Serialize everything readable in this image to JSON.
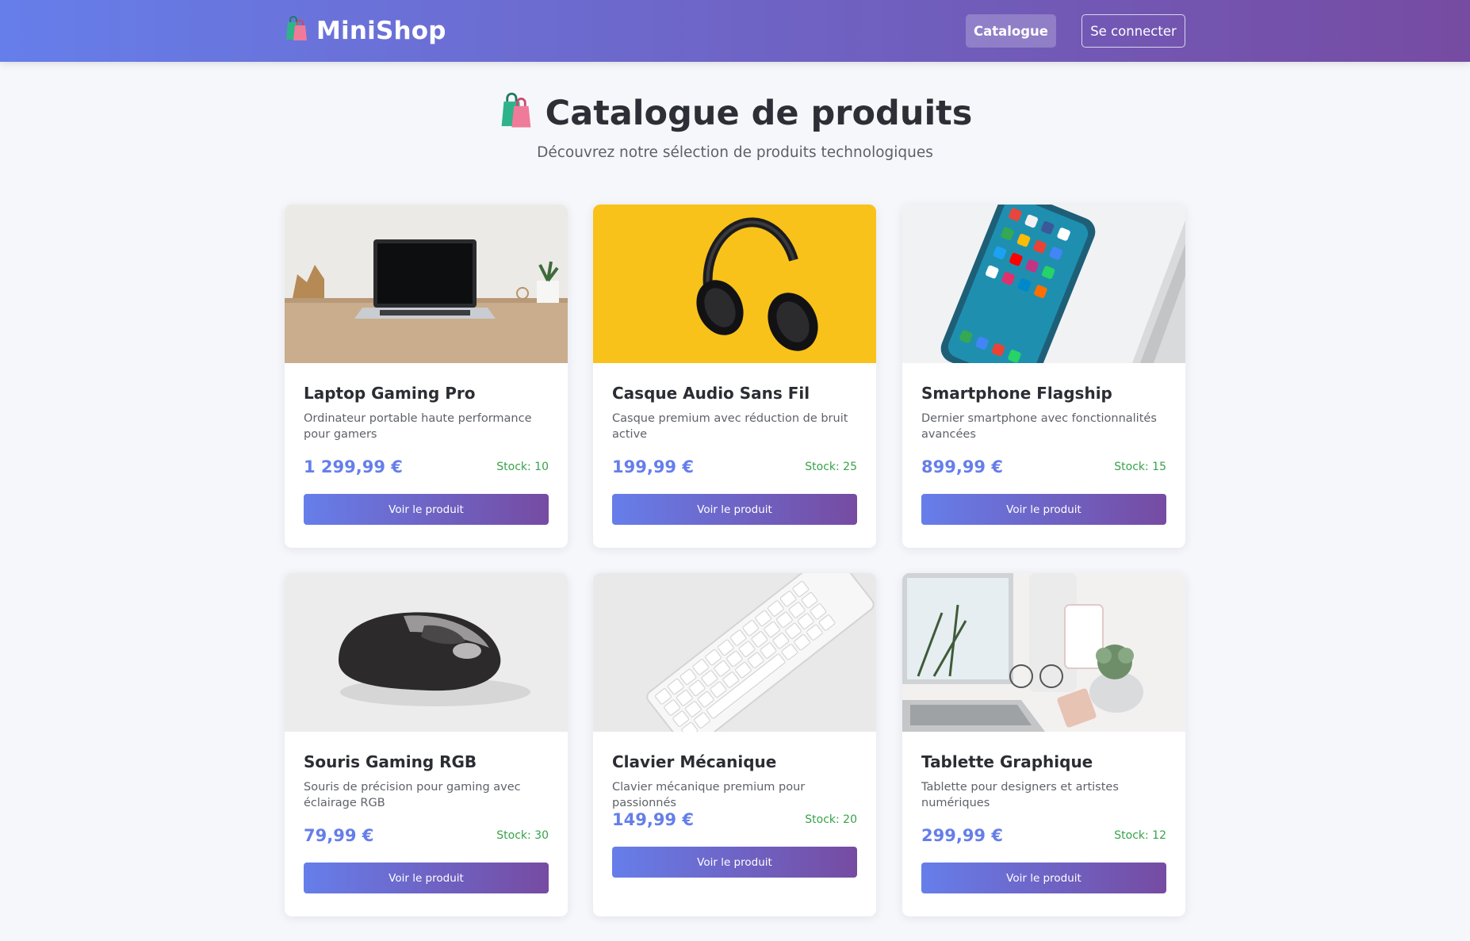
{
  "header": {
    "brand": "MiniShop",
    "brand_icon": "shopping-bags-icon",
    "nav": {
      "catalogue": "Catalogue",
      "login": "Se connecter"
    }
  },
  "hero": {
    "title": "Catalogue de produits",
    "subtitle": "Découvrez notre sélection de produits technologiques"
  },
  "colors": {
    "primary": "#667eea",
    "secondary": "#764ba2",
    "stock": "#37a24a"
  },
  "products": [
    {
      "name": "Laptop Gaming Pro",
      "description": "Ordinateur portable haute performance pour gamers",
      "price": "1 299,99 €",
      "stock": "Stock: 10",
      "button": "Voir le produit"
    },
    {
      "name": "Casque Audio Sans Fil",
      "description": "Casque premium avec réduction de bruit active",
      "price": "199,99 €",
      "stock": "Stock: 25",
      "button": "Voir le produit"
    },
    {
      "name": "Smartphone Flagship",
      "description": "Dernier smartphone avec fonctionnalités avancées",
      "price": "899,99 €",
      "stock": "Stock: 15",
      "button": "Voir le produit"
    },
    {
      "name": "Souris Gaming RGB",
      "description": "Souris de précision pour gaming avec éclairage RGB",
      "price": "79,99 €",
      "stock": "Stock: 30",
      "button": "Voir le produit"
    },
    {
      "name": "Clavier Mécanique",
      "description": "Clavier mécanique premium pour passionnés",
      "price": "149,99 €",
      "stock": "Stock: 20",
      "button": "Voir le produit"
    },
    {
      "name": "Tablette Graphique",
      "description": "Tablette pour designers et artistes numériques",
      "price": "299,99 €",
      "stock": "Stock: 12",
      "button": "Voir le produit"
    }
  ]
}
